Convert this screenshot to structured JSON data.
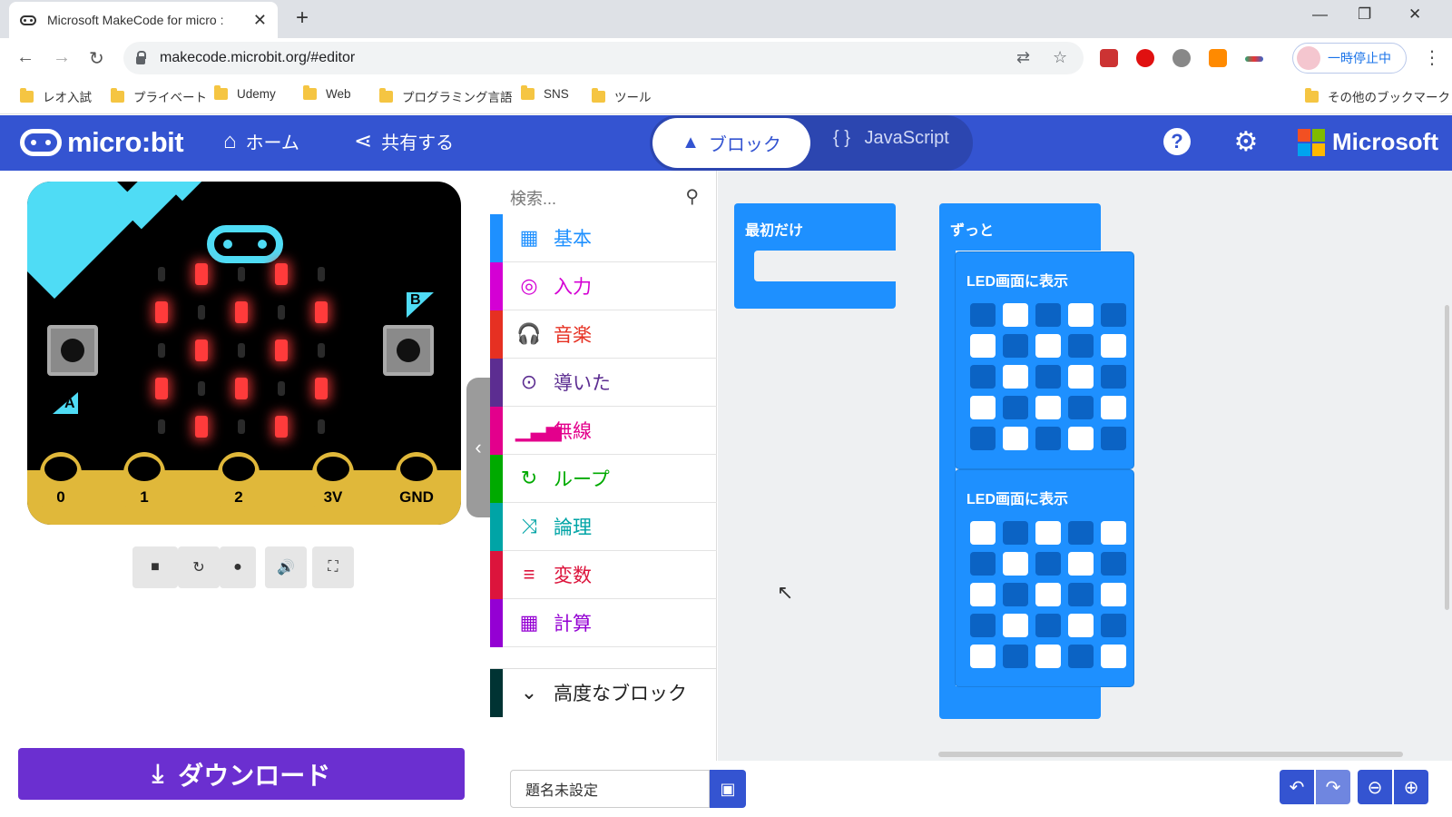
{
  "browser": {
    "tab_title": "Microsoft MakeCode for micro :",
    "url": "makecode.microbit.org/#editor",
    "profile_status": "一時停止中",
    "bookmarks": [
      "レオ入試",
      "プライベート",
      "Udemy",
      "Web",
      "プログラミング言語",
      "SNS",
      "ツール"
    ],
    "other_bookmarks": "その他のブックマーク"
  },
  "header": {
    "brand": "micro:bit",
    "home": "ホーム",
    "share": "共有する",
    "blocks_tab": "ブロック",
    "js_tab": "JavaScript",
    "microsoft": "Microsoft"
  },
  "simulator": {
    "button_a": "A",
    "button_b": "B",
    "pins": [
      "0",
      "1",
      "2",
      "3V",
      "GND"
    ],
    "leds": [
      [
        0,
        1,
        0,
        1,
        0
      ],
      [
        1,
        0,
        1,
        0,
        1
      ],
      [
        0,
        1,
        0,
        1,
        0
      ],
      [
        1,
        0,
        1,
        0,
        1
      ],
      [
        0,
        1,
        0,
        1,
        0
      ]
    ]
  },
  "download_label": "ダウンロード",
  "toolbox": {
    "search_placeholder": "検索...",
    "categories": [
      {
        "label": "基本",
        "color": "#1e90ff",
        "icon": "grid-icon"
      },
      {
        "label": "入力",
        "color": "#d400d4",
        "icon": "target-icon"
      },
      {
        "label": "音楽",
        "color": "#e63022",
        "icon": "headphones-icon"
      },
      {
        "label": "導いた",
        "color": "#5c2d91",
        "icon": "toggle-icon"
      },
      {
        "label": "無線",
        "color": "#e3008c",
        "icon": "signal-icon"
      },
      {
        "label": "ループ",
        "color": "#00aa00",
        "icon": "refresh-icon"
      },
      {
        "label": "論理",
        "color": "#00a4a6",
        "icon": "shuffle-icon"
      },
      {
        "label": "変数",
        "color": "#dc143c",
        "icon": "lines-icon"
      },
      {
        "label": "計算",
        "color": "#9400d3",
        "icon": "calculator-icon"
      }
    ],
    "advanced": "高度なブロック"
  },
  "workspace": {
    "on_start": "最初だけ",
    "forever": "ずっと",
    "show_leds_1": "LED画面に表示",
    "show_leds_2": "LED画面に表示",
    "grid1": [
      [
        0,
        1,
        0,
        1,
        0
      ],
      [
        1,
        0,
        1,
        0,
        1
      ],
      [
        0,
        1,
        0,
        1,
        0
      ],
      [
        1,
        0,
        1,
        0,
        1
      ],
      [
        0,
        1,
        0,
        1,
        0
      ]
    ],
    "grid2": [
      [
        1,
        0,
        1,
        0,
        1
      ],
      [
        0,
        1,
        0,
        1,
        0
      ],
      [
        1,
        0,
        1,
        0,
        1
      ],
      [
        0,
        1,
        0,
        1,
        0
      ],
      [
        1,
        0,
        1,
        0,
        1
      ]
    ]
  },
  "project_name": "題名未設定"
}
